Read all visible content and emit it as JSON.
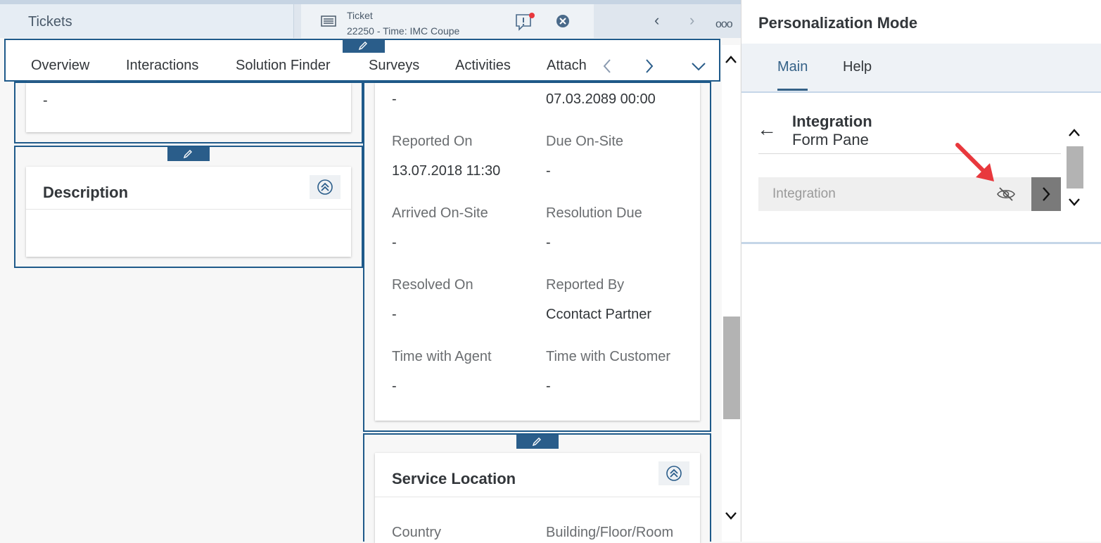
{
  "top_tabs": {
    "tickets_label": "Tickets",
    "ticket": {
      "title": "Ticket",
      "subtitle": "22250 - Time: IMC Coupe"
    },
    "icons": [
      "list-icon",
      "alert-icon",
      "close-icon",
      "chevron-left-icon",
      "chevron-right-icon",
      "more-icon"
    ],
    "more_label": "ooo"
  },
  "sub_tabs": {
    "items": [
      "Overview",
      "Interactions",
      "Solution Finder",
      "Surveys",
      "Activities",
      "Attach"
    ],
    "active": "Overview"
  },
  "left_card_top": {
    "value": "-"
  },
  "description_card": {
    "title": "Description"
  },
  "dates_card": {
    "row0": {
      "left_value": "-",
      "right_value": "07.03.2089 00:00"
    },
    "fields": [
      {
        "label": "Reported On",
        "value": "13.07.2018 11:30"
      },
      {
        "label": "Due On-Site",
        "value": "-"
      },
      {
        "label": "Arrived On-Site",
        "value": "-"
      },
      {
        "label": "Resolution Due",
        "value": "-"
      },
      {
        "label": "Resolved On",
        "value": "-"
      },
      {
        "label": "Reported By",
        "value": "Ccontact Partner"
      },
      {
        "label": "Time with Agent",
        "value": "-"
      },
      {
        "label": "Time with Customer",
        "value": "-"
      }
    ]
  },
  "service_location_card": {
    "title": "Service Location",
    "fields": [
      {
        "label": "Country"
      },
      {
        "label": "Building/Floor/Room"
      }
    ]
  },
  "personalization": {
    "title": "Personalization Mode",
    "tabs": [
      "Main",
      "Help"
    ],
    "active_tab": "Main",
    "section_title": "Integration",
    "section_subtitle": "Form Pane",
    "item_label": "Integration"
  },
  "colors": {
    "accent": "#346187",
    "frame": "#1f5a8a",
    "annotation_arrow": "#e8383d"
  }
}
